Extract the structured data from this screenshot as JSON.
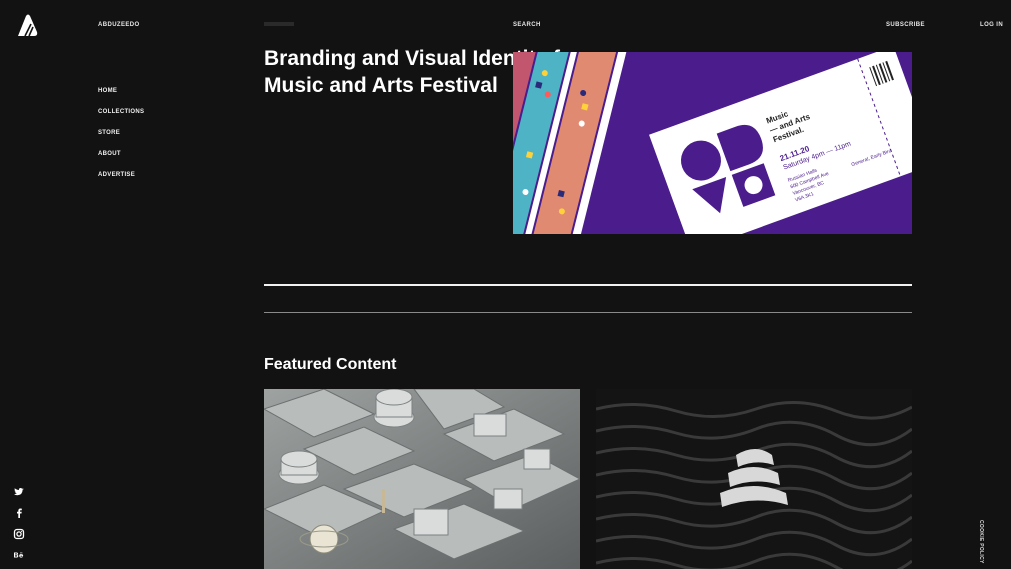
{
  "header": {
    "brand": "ABDUZEEDO",
    "search": "SEARCH",
    "subscribe": "SUBSCRIBE",
    "login": "LOG IN"
  },
  "nav": {
    "items": [
      "HOME",
      "COLLECTIONS",
      "STORE",
      "ABOUT",
      "ADVERTISE"
    ]
  },
  "social": [
    "twitter-icon",
    "facebook-icon",
    "instagram-icon",
    "behance-icon"
  ],
  "article": {
    "title": "Branding and Visual Identity for Music and Arts Festival"
  },
  "hero_ticket": {
    "event": "Music and Arts Festival",
    "date": "21.11.20",
    "time": "Saturday 4pm — 11pm",
    "venue": "Russian Halls",
    "address1": "600 Campbell Ave",
    "address2": "Vancouver, BC",
    "address3": "V6A 3K1",
    "admission": "General, Early Bird"
  },
  "featured": {
    "heading": "Featured Content"
  },
  "footer": {
    "cookie": "COOKIE POLICY"
  },
  "colors": {
    "background": "#121212",
    "ticket_purple": "#4a1c8c",
    "ticket_teal": "#4fb3c6",
    "ticket_salmon": "#e08a72"
  }
}
